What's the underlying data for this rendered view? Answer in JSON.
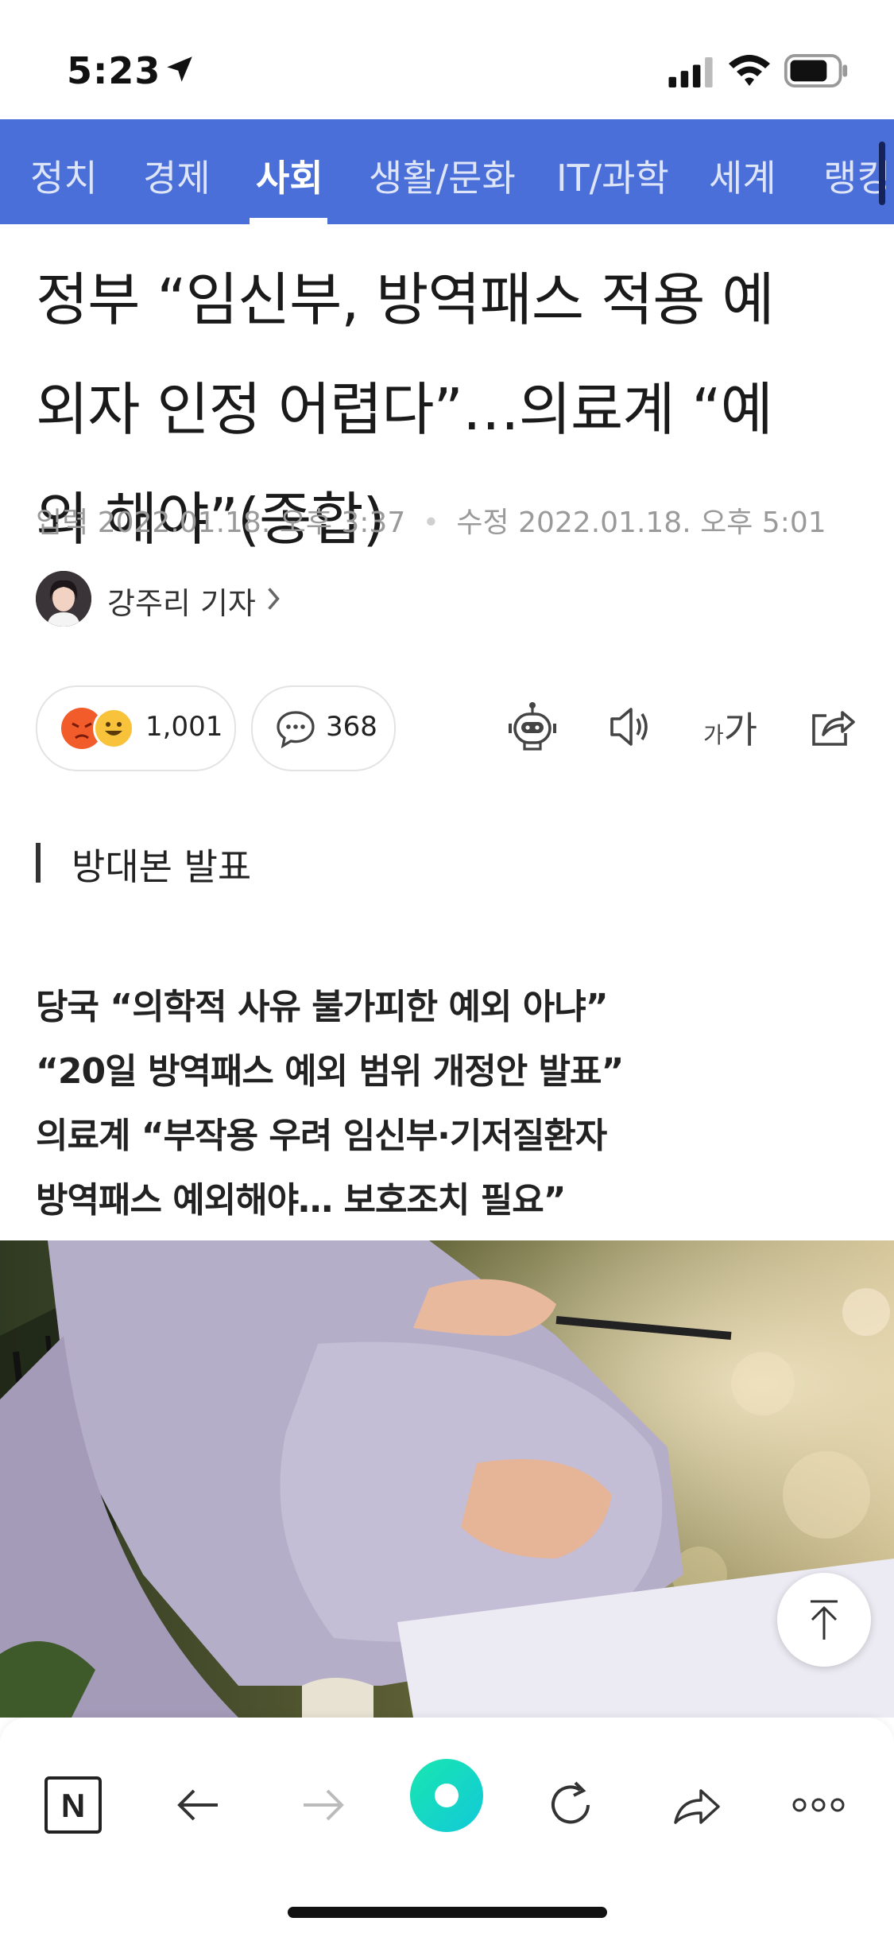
{
  "status_bar": {
    "time": "5:23"
  },
  "nav": {
    "tabs": [
      {
        "label": "정치"
      },
      {
        "label": "경제"
      },
      {
        "label": "사회"
      },
      {
        "label": "생활/문화"
      },
      {
        "label": "IT/과학"
      },
      {
        "label": "세계"
      },
      {
        "label": "랭킹"
      }
    ],
    "active_tab": "사회"
  },
  "article": {
    "headline_lines": [
      "정부 “임신부, 방역패스 적용 예",
      "외자 인정 어렵다”…의료계 “예",
      "외 해야”(종합)"
    ],
    "meta": {
      "input_label": "입력",
      "input_time": "2022.01.18. 오후 3:37",
      "edit_label": "수정",
      "edit_time": "2022.01.18. 오후 5:01"
    },
    "reporter": "강주리 기자",
    "reaction_count": "1,001",
    "comment_count": "368",
    "font_size_small": "가",
    "font_size_large": "가",
    "section_title": "방대본 발표",
    "subheads": [
      "당국 “의학적 사유 불가피한 예외 아냐”",
      "“20일 방역패스 예외 범위 개정안 발표”",
      "의료계 “부작용 우려 임신부·기저질환자",
      "방역패스 예외해야… 보호조치 필요”"
    ]
  },
  "toolbar": {
    "home_letter": "N"
  },
  "colors": {
    "nav_bg": "#4a6fd8",
    "accent_green": "#1fe0a0",
    "meta_gray": "#9a9a9a"
  }
}
